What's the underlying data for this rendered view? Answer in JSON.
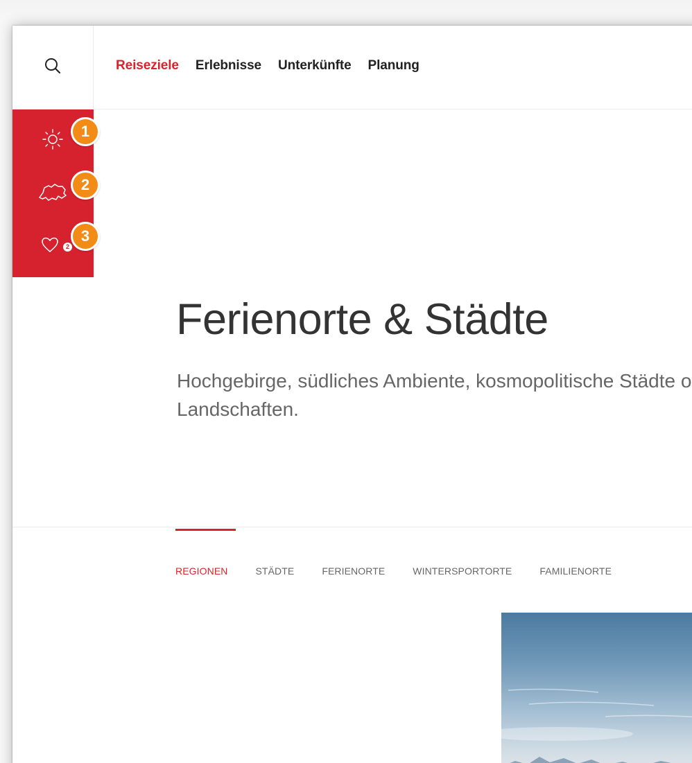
{
  "header": {
    "nav": [
      {
        "label": "Reiseziele",
        "active": true
      },
      {
        "label": "Erlebnisse",
        "active": false
      },
      {
        "label": "Unterkünfte",
        "active": false
      },
      {
        "label": "Planung",
        "active": false
      }
    ]
  },
  "sidebar": {
    "items": [
      {
        "icon": "sun-icon",
        "marker": "1"
      },
      {
        "icon": "switzerland-map-icon",
        "marker": "2"
      },
      {
        "icon": "heart-icon",
        "marker": "3",
        "count": "2"
      }
    ]
  },
  "hero": {
    "title": "Ferienorte & Städte",
    "subtitle": "Hochgebirge, südliches Ambiente, kosmopolitische Städte oder unberührte Landschaften."
  },
  "tabs": [
    {
      "label": "REGIONEN",
      "active": true
    },
    {
      "label": "STÄDTE",
      "active": false
    },
    {
      "label": "FERIENORTE",
      "active": false
    },
    {
      "label": "WINTERSPORTORTE",
      "active": false
    },
    {
      "label": "FAMILIENORTE",
      "active": false
    }
  ],
  "colors": {
    "accent": "#d8232a",
    "sidebar": "#d6212e",
    "marker": "#f28c16"
  }
}
